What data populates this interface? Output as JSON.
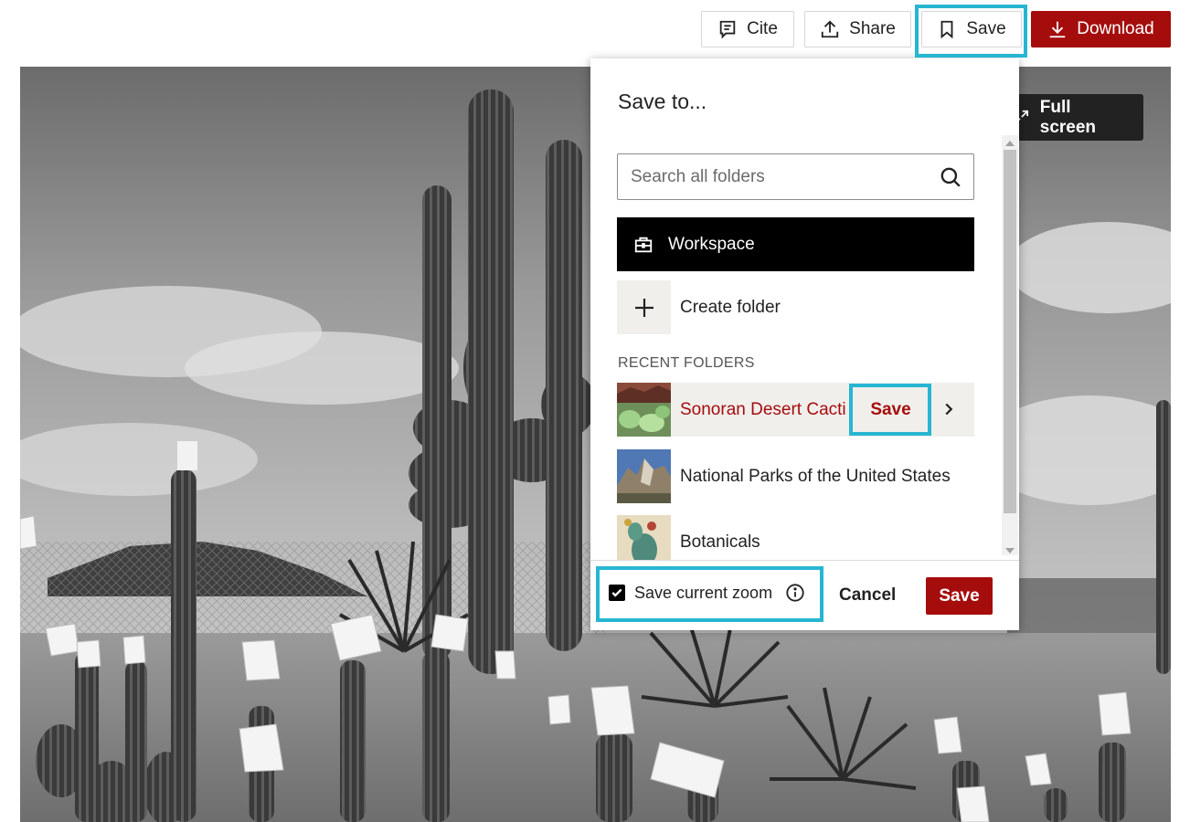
{
  "toolbar": {
    "cite_label": "Cite",
    "share_label": "Share",
    "save_label": "Save",
    "download_label": "Download"
  },
  "viewer": {
    "fullscreen_label": "Full screen"
  },
  "save_dialog": {
    "title": "Save to...",
    "search_placeholder": "Search all folders",
    "workspace_label": "Workspace",
    "create_folder_label": "Create folder",
    "recent_folders_heading": "RECENT FOLDERS",
    "recent_folders": [
      {
        "name": "Sonoran Desert Cacti",
        "save_label": "Save"
      },
      {
        "name": "National Parks of the United States"
      },
      {
        "name": "Botanicals"
      }
    ],
    "save_zoom_label": "Save current zoom",
    "save_zoom_checked": true,
    "cancel_label": "Cancel",
    "save_label": "Save"
  },
  "colors": {
    "brand_red": "#a50d0d",
    "highlight_cyan": "#27b6d2",
    "workspace_black": "#000000"
  },
  "icons": [
    "cite-icon",
    "share-icon",
    "bookmark-icon",
    "download-icon",
    "expand-icon",
    "search-icon",
    "briefcase-icon",
    "plus-icon",
    "chevron-right-icon",
    "info-icon",
    "check-icon"
  ]
}
